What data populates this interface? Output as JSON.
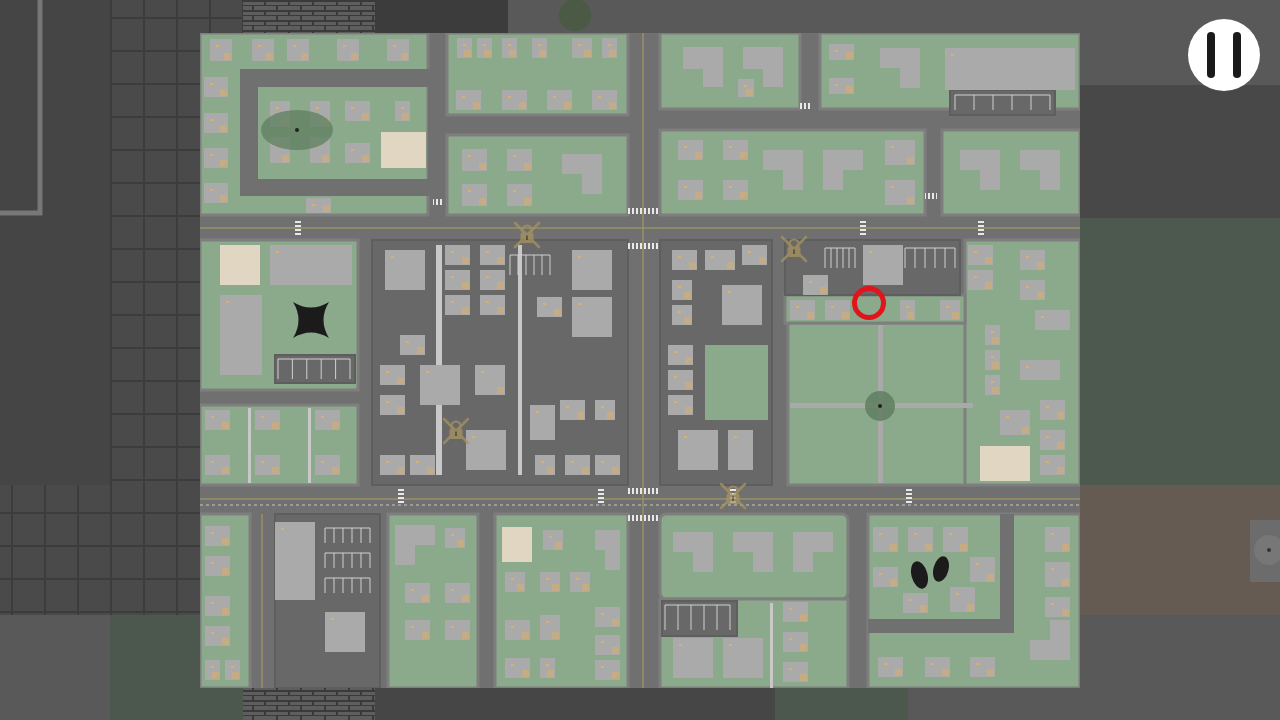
{
  "map": {
    "markers": [
      {
        "kind": "ring"
      },
      {
        "kind": "star"
      },
      {
        "kind": "footprints"
      },
      {
        "kind": "drone"
      },
      {
        "kind": "drone"
      },
      {
        "kind": "drone"
      },
      {
        "kind": "drone"
      }
    ]
  },
  "controls": [
    {
      "kind": "pause"
    }
  ]
}
